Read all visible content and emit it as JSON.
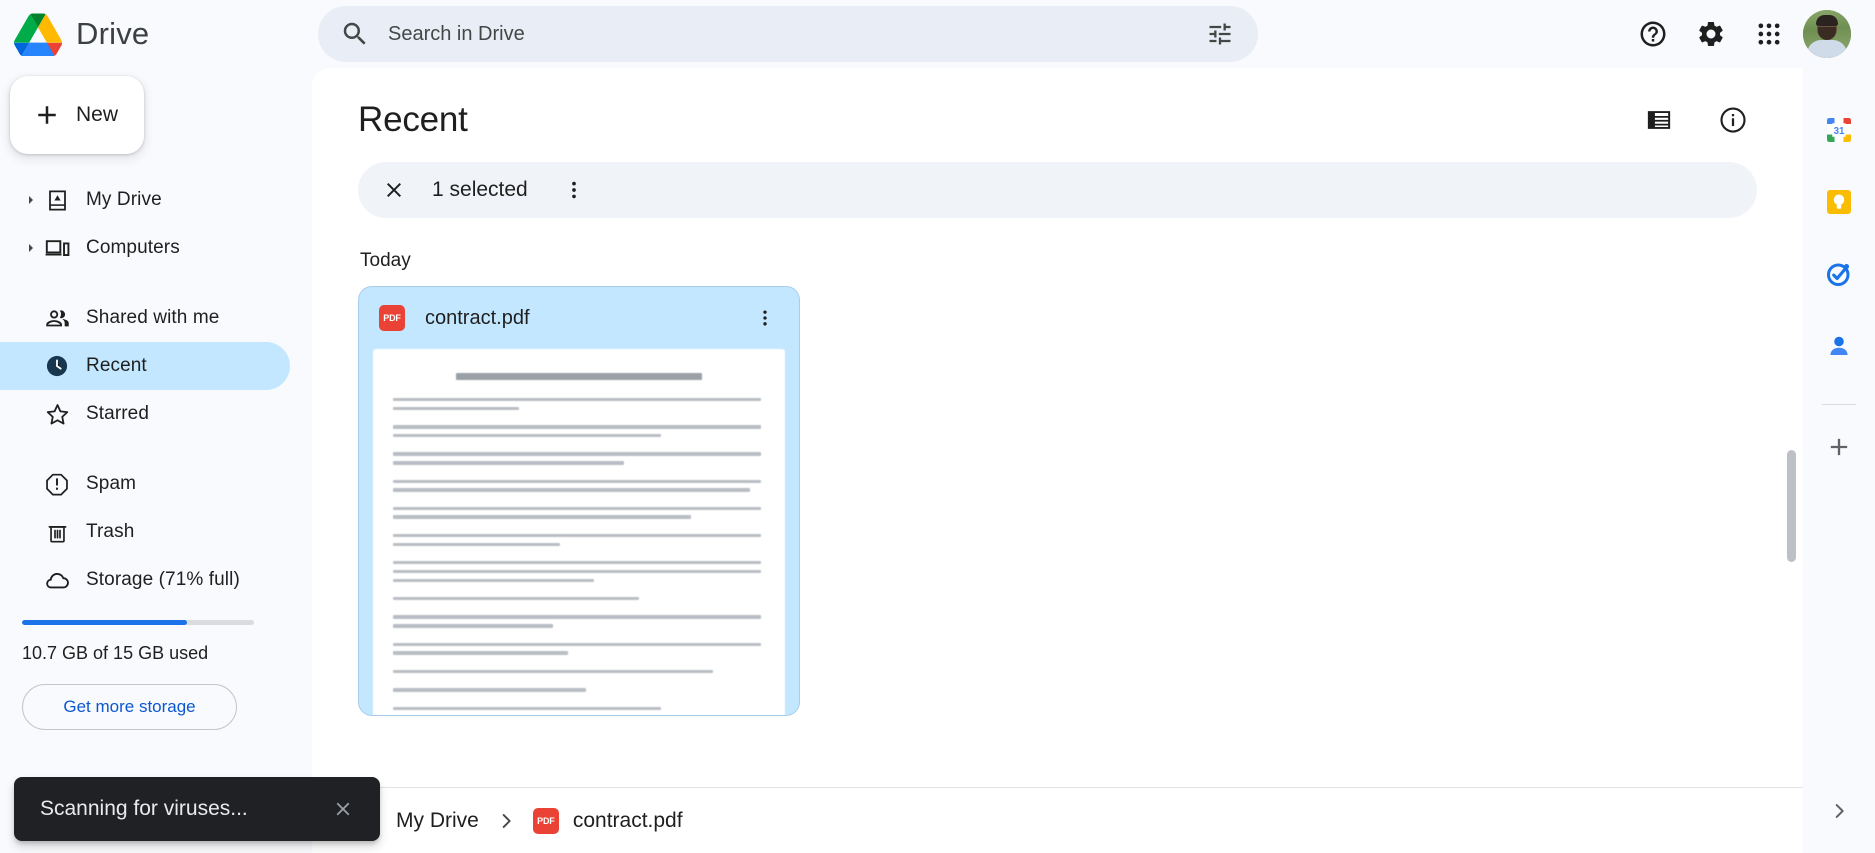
{
  "app": {
    "brand_title": "Drive",
    "logo_icon": "google-drive-logo"
  },
  "search": {
    "placeholder": "Search in Drive",
    "value": "",
    "icon": "search-icon",
    "options_icon": "tune-icon"
  },
  "header": {
    "actions": [
      {
        "name": "help",
        "icon": "help-circle-icon",
        "label": "Support"
      },
      {
        "name": "settings",
        "icon": "gear-icon",
        "label": "Settings"
      },
      {
        "name": "apps",
        "icon": "apps-grid-icon",
        "label": "Google apps"
      }
    ],
    "avatar": {
      "icon": "avatar",
      "label": "Google Account"
    }
  },
  "sidebar": {
    "new_button": {
      "label": "New",
      "icon": "plus-icon"
    },
    "items": [
      {
        "label": "My Drive",
        "icon": "my-drive-icon",
        "expandable": true,
        "active": false
      },
      {
        "label": "Computers",
        "icon": "computers-icon",
        "expandable": true,
        "active": false
      },
      {
        "label": "Shared with me",
        "icon": "shared-people-icon",
        "expandable": false,
        "active": false
      },
      {
        "label": "Recent",
        "icon": "clock-icon",
        "expandable": false,
        "active": true
      },
      {
        "label": "Starred",
        "icon": "star-icon",
        "expandable": false,
        "active": false
      },
      {
        "label": "Spam",
        "icon": "spam-icon",
        "expandable": false,
        "active": false
      },
      {
        "label": "Trash",
        "icon": "trash-icon",
        "expandable": false,
        "active": false
      },
      {
        "label": "Storage (71% full)",
        "icon": "cloud-icon",
        "expandable": false,
        "active": false
      }
    ],
    "storage": {
      "percent": 71,
      "usage_text": "10.7 GB of 15 GB used",
      "buy_label": "Get more storage",
      "bar_color": "#1a73e8"
    }
  },
  "main": {
    "page_title": "Recent",
    "view_toggle": {
      "icon": "list-view-icon",
      "label": "List layout"
    },
    "info": {
      "icon": "info-circle-icon",
      "label": "View details"
    },
    "selection": {
      "close_icon": "close-icon",
      "count_label": "1 selected",
      "more_icon": "more-vert-icon"
    },
    "section_label": "Today",
    "file": {
      "name": "contract.pdf",
      "type_badge": "PDF",
      "type_color": "#ea4335",
      "more_icon": "more-vert-icon",
      "selected": true,
      "thumbnail_alt": "Contract for photographic services document preview"
    }
  },
  "breadcrumb": {
    "items": [
      {
        "label": "My Drive",
        "icon": "my-drive-icon"
      },
      {
        "label": "contract.pdf",
        "icon": "pdf-icon",
        "badge": "PDF"
      }
    ],
    "separator_icon": "chevron-right-icon"
  },
  "rail": {
    "items": [
      {
        "name": "calendar",
        "icon": "google-calendar-icon",
        "badge": "31"
      },
      {
        "name": "keep",
        "icon": "google-keep-icon"
      },
      {
        "name": "tasks",
        "icon": "google-tasks-icon"
      },
      {
        "name": "contacts",
        "icon": "google-contacts-icon"
      }
    ],
    "add": {
      "icon": "plus-icon",
      "label": "Get add-ons"
    },
    "expand": {
      "icon": "chevron-right-icon",
      "label": "Show side panel"
    }
  },
  "toast": {
    "message": "Scanning for viruses...",
    "close_icon": "close-icon"
  },
  "colors": {
    "accent_blue": "#0b57d0",
    "selection_blue": "#c2e7ff",
    "surface": "#f8fafd",
    "toast_bg": "#202124",
    "pdf_red": "#ea4335"
  }
}
